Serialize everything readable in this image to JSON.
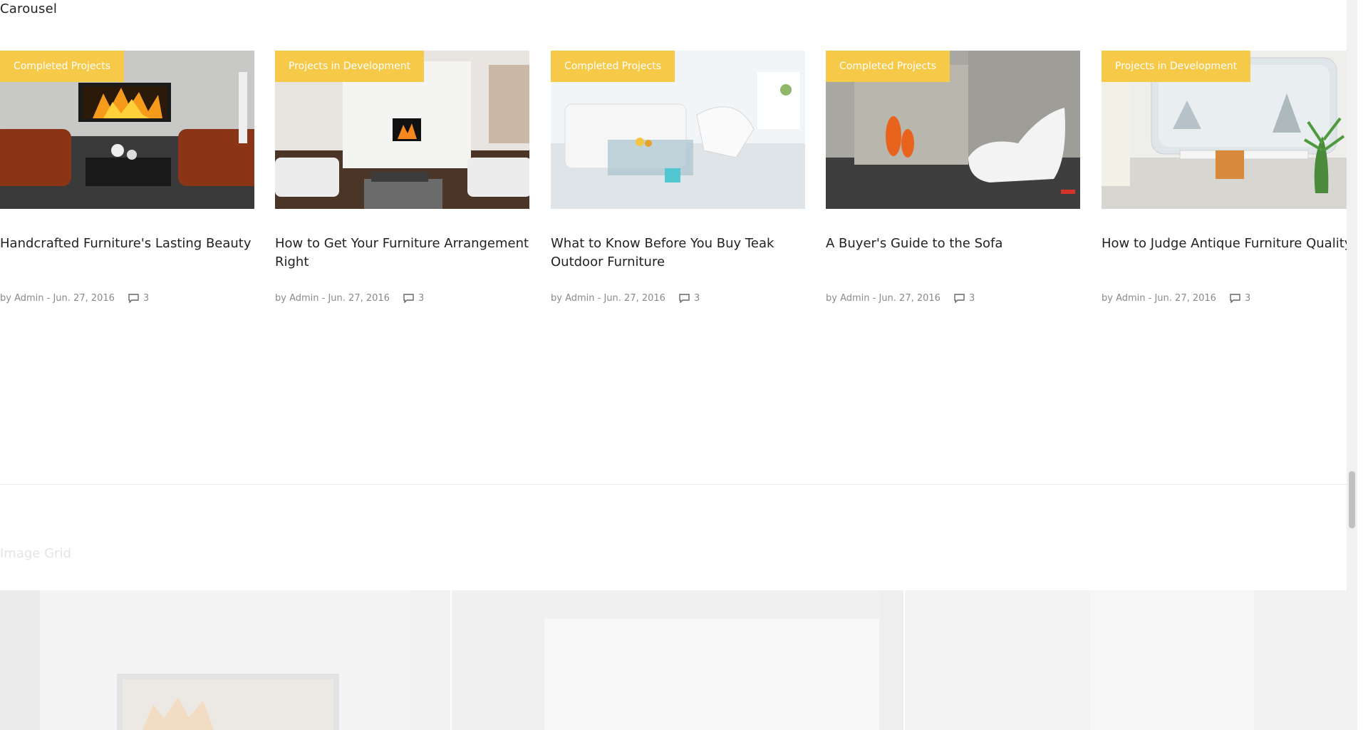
{
  "section_title": "Carousel",
  "cards": [
    {
      "badge": "Completed Projects",
      "title": "Handcrafted Furniture's Lasting Beauty",
      "meta": "by Admin - Jun. 27, 2016",
      "comments": "3"
    },
    {
      "badge": "Projects in Development",
      "title": "How to Get Your Furniture Arrangement Right",
      "meta": "by Admin - Jun. 27, 2016",
      "comments": "3"
    },
    {
      "badge": "Completed Projects",
      "title": "What to Know Before You Buy Teak Outdoor Furniture",
      "meta": "by Admin - Jun. 27, 2016",
      "comments": "3"
    },
    {
      "badge": "Completed Projects",
      "title": "A Buyer's Guide to the Sofa",
      "meta": "by Admin - Jun. 27, 2016",
      "comments": "3"
    },
    {
      "badge": "Projects in Development",
      "title": "How to Judge Antique Furniture Quality",
      "meta": "by Admin - Jun. 27, 2016",
      "comments": "3"
    }
  ],
  "grid_title": "Image Grid",
  "colors": {
    "badge": "#f7c948",
    "meta": "#8a8a8a",
    "title": "#222222"
  }
}
